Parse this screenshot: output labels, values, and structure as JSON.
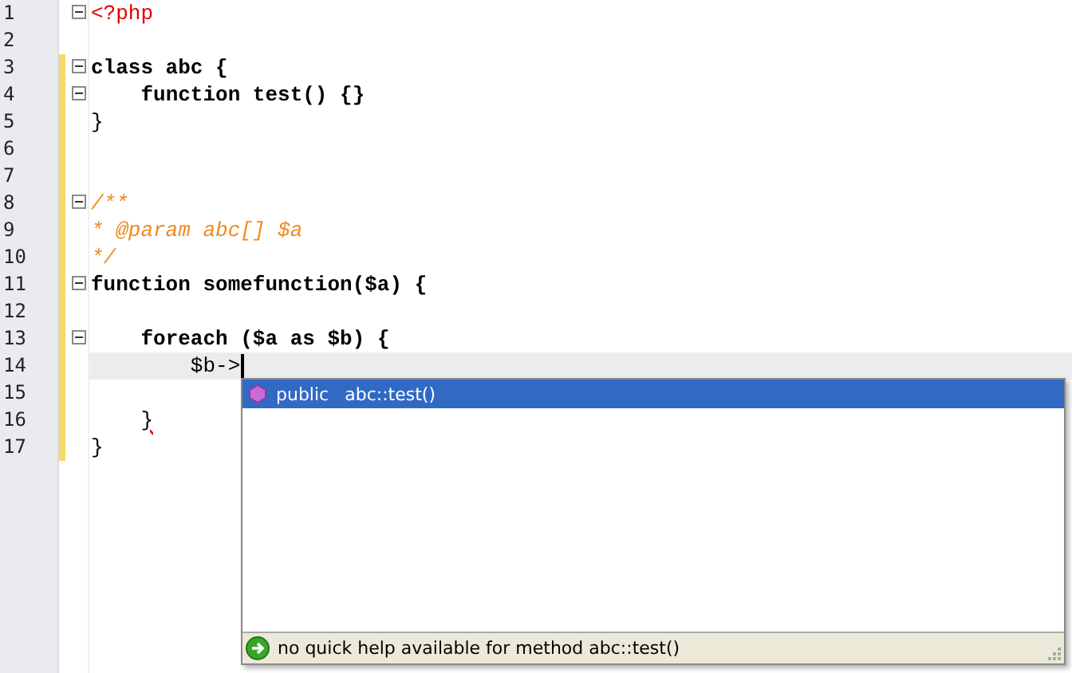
{
  "editor": {
    "lines": [
      {
        "number": "1",
        "fold": true,
        "changed": false,
        "current": false,
        "tokens": [
          {
            "text": "<?php",
            "kind": "tag"
          }
        ]
      },
      {
        "number": "2",
        "fold": false,
        "changed": false,
        "current": false
      },
      {
        "number": "3",
        "fold": true,
        "changed": true,
        "current": false,
        "tokens": [
          {
            "text": "class abc {",
            "kind": "keyword"
          }
        ]
      },
      {
        "number": "4",
        "fold": true,
        "changed": true,
        "current": false,
        "tokens": [
          {
            "text": "    function test() {}",
            "kind": "keyword"
          }
        ]
      },
      {
        "number": "5",
        "fold": false,
        "changed": true,
        "current": false,
        "tokens": [
          {
            "text": "}",
            "kind": "plain"
          }
        ]
      },
      {
        "number": "6",
        "fold": false,
        "changed": true,
        "current": false
      },
      {
        "number": "7",
        "fold": false,
        "changed": true,
        "current": false
      },
      {
        "number": "8",
        "fold": true,
        "changed": true,
        "current": false,
        "tokens": [
          {
            "text": "/**",
            "kind": "comment"
          }
        ]
      },
      {
        "number": "9",
        "fold": false,
        "changed": true,
        "current": false,
        "tokens": [
          {
            "text": "* @param abc[] $a",
            "kind": "comment"
          }
        ]
      },
      {
        "number": "10",
        "fold": false,
        "changed": true,
        "current": false,
        "tokens": [
          {
            "text": "*/",
            "kind": "comment"
          }
        ]
      },
      {
        "number": "11",
        "fold": true,
        "changed": true,
        "current": false,
        "tokens": [
          {
            "text": "function somefunction($a) {",
            "kind": "keyword"
          }
        ]
      },
      {
        "number": "12",
        "fold": false,
        "changed": true,
        "current": false
      },
      {
        "number": "13",
        "fold": true,
        "changed": true,
        "current": false,
        "tokens": [
          {
            "text": "    foreach ($a as $b) {",
            "kind": "keyword"
          }
        ]
      },
      {
        "number": "14",
        "fold": false,
        "changed": true,
        "current": true,
        "tokens": [
          {
            "text": "        $b->",
            "kind": "plain"
          }
        ]
      },
      {
        "number": "15",
        "fold": false,
        "changed": true,
        "current": false
      },
      {
        "number": "16",
        "fold": false,
        "changed": true,
        "current": false,
        "tokens": [
          {
            "text": "    }",
            "kind": "error"
          }
        ]
      },
      {
        "number": "17",
        "fold": false,
        "changed": true,
        "current": false,
        "tokens": [
          {
            "text": "}",
            "kind": "plain"
          }
        ]
      }
    ]
  },
  "completion": {
    "items": [
      {
        "modifier": "public",
        "signature": "abc::test()",
        "selected": true
      }
    ],
    "status": "no quick help available for method abc::test()"
  }
}
